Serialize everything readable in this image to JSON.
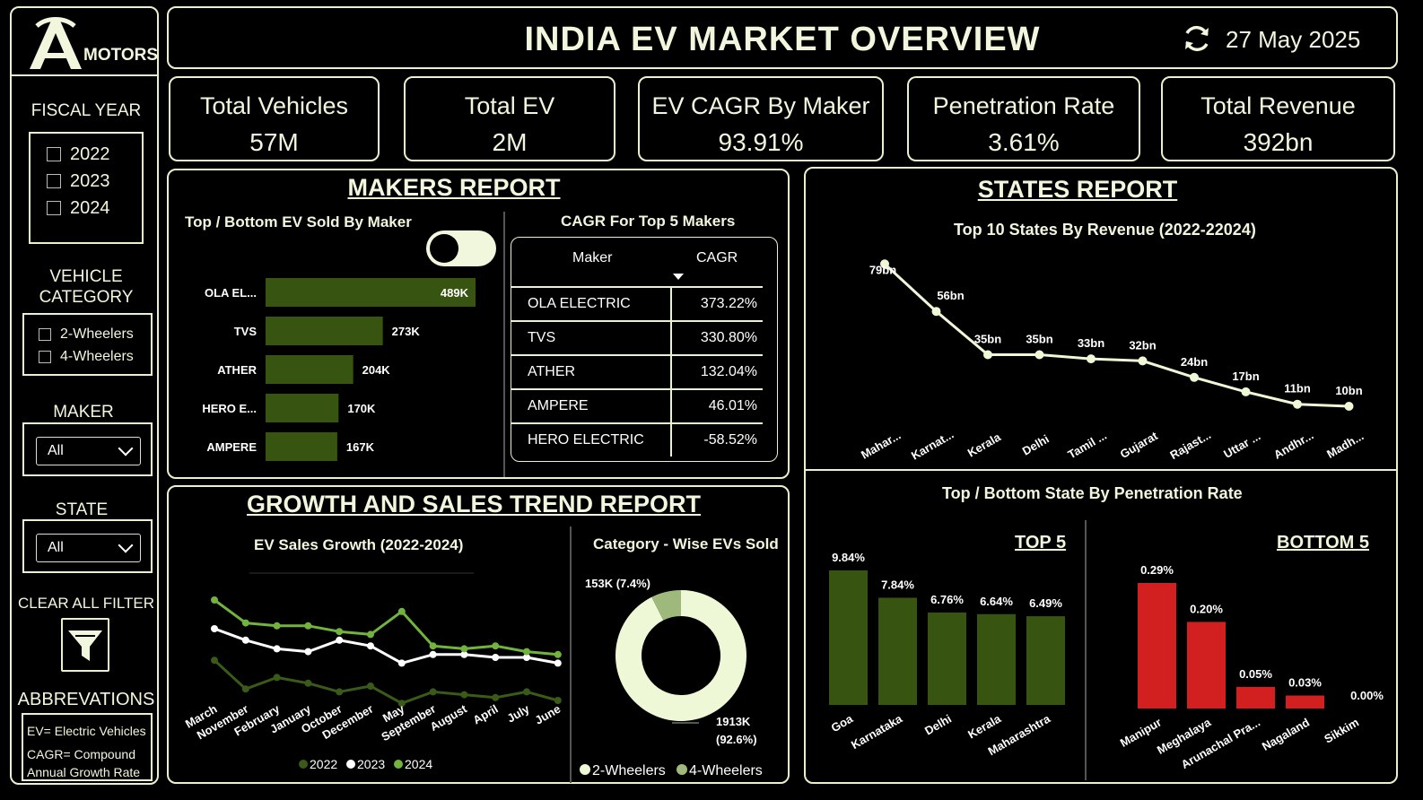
{
  "header": {
    "title": "INDIA EV MARKET OVERVIEW",
    "date": "27 May 2025"
  },
  "logo": {
    "text": "MOTORS",
    "letter": "A"
  },
  "sidebar": {
    "fiscal_year_label": "FISCAL YEAR",
    "fiscal_years": [
      "2022",
      "2023",
      "2024"
    ],
    "vehicle_category_label": "VEHICLE\nCATEGORY",
    "vehicle_categories": [
      "2-Wheelers",
      "4-Wheelers"
    ],
    "maker_label": "MAKER",
    "maker_value": "All",
    "state_label": "STATE",
    "state_value": "All",
    "clear_label": "CLEAR ALL FILTER",
    "abbrev_label": "ABBREVATIONS",
    "abbrev_lines": [
      "EV= Electric Vehicles",
      "CAGR= Compound",
      "Annual Growth Rate"
    ]
  },
  "kpis": [
    {
      "title": "Total Vehicles",
      "value": "57M"
    },
    {
      "title": "Total EV",
      "value": "2M"
    },
    {
      "title": "EV CAGR By Maker",
      "value": "93.91%"
    },
    {
      "title": "Penetration Rate",
      "value": "3.61%"
    },
    {
      "title": "Total Revenue",
      "value": "392bn"
    }
  ],
  "makers_report": {
    "title": "MAKERS REPORT",
    "bar_title": "Top / Bottom EV Sold By Maker",
    "table_title": "CAGR For Top 5 Makers",
    "table_headers": [
      "Maker",
      "CAGR"
    ],
    "table_rows": [
      [
        "OLA ELECTRIC",
        "373.22%"
      ],
      [
        "TVS",
        "330.80%"
      ],
      [
        "ATHER",
        "132.04%"
      ],
      [
        "AMPERE",
        "46.01%"
      ],
      [
        "HERO ELECTRIC",
        "-58.52%"
      ]
    ]
  },
  "states_report": {
    "title": "STATES REPORT",
    "line_title": "Top 10 States By Revenue (2022-22024)",
    "pen_title": "Top / Bottom State By Penetration Rate",
    "top_label": "TOP 5",
    "bottom_label": "BOTTOM 5"
  },
  "growth_report": {
    "title": "GROWTH AND SALES TREND REPORT",
    "line_title": "EV Sales Growth (2022-2024)",
    "donut_title": "Category - Wise EVs Sold"
  },
  "colors": {
    "accent": "#e8f2cc",
    "bar_green": "#375410",
    "bar_red": "#d21f1f",
    "line_2024": "#72b33e",
    "line_2022": "#3a5a18",
    "donut_main": "#eef8d6",
    "donut_small": "#9fb97c"
  },
  "chart_data": [
    {
      "id": "maker_bars",
      "type": "bar",
      "orientation": "horizontal",
      "title": "Top / Bottom EV Sold By Maker",
      "categories": [
        "OLA EL...",
        "TVS",
        "ATHER",
        "HERO E...",
        "AMPERE"
      ],
      "values": [
        489,
        273,
        204,
        170,
        167
      ],
      "labels": [
        "489K",
        "273K",
        "204K",
        "170K",
        "167K"
      ],
      "unit": "K"
    },
    {
      "id": "state_revenue",
      "type": "line",
      "title": "Top 10 States By Revenue (2022-22024)",
      "categories": [
        "Mahar...",
        "Karnat...",
        "Kerala",
        "Delhi",
        "Tamil ...",
        "Gujarat",
        "Rajast...",
        "Uttar ...",
        "Andhr...",
        "Madh..."
      ],
      "values": [
        79,
        56,
        35,
        35,
        33,
        32,
        24,
        17,
        11,
        10
      ],
      "labels": [
        "79bn",
        "56bn",
        "35bn",
        "35bn",
        "33bn",
        "32bn",
        "24bn",
        "17bn",
        "11bn",
        "10bn"
      ]
    },
    {
      "id": "top5_penetration",
      "type": "bar",
      "title": "TOP 5",
      "categories": [
        "Goa",
        "Karnataka",
        "Delhi",
        "Kerala",
        "Maharashtra"
      ],
      "values": [
        9.84,
        7.84,
        6.76,
        6.64,
        6.49
      ],
      "labels": [
        "9.84%",
        "7.84%",
        "6.76%",
        "6.64%",
        "6.49%"
      ]
    },
    {
      "id": "bottom5_penetration",
      "type": "bar",
      "title": "BOTTOM 5",
      "categories": [
        "Manipur",
        "Meghalaya",
        "Arunachal Pra...",
        "Nagaland",
        "Sikkim"
      ],
      "values": [
        0.29,
        0.2,
        0.05,
        0.03,
        0.0
      ],
      "labels": [
        "0.29%",
        "0.20%",
        "0.05%",
        "0.03%",
        "0.00%"
      ]
    },
    {
      "id": "sales_growth",
      "type": "line",
      "title": "EV Sales Growth (2022-2024)",
      "categories": [
        "March",
        "November",
        "February",
        "January",
        "October",
        "December",
        "May",
        "September",
        "August",
        "April",
        "July",
        "June"
      ],
      "series": [
        {
          "name": "2022",
          "values": [
            69,
            59,
            63,
            61,
            58,
            60,
            54,
            58,
            57,
            56,
            58,
            55
          ]
        },
        {
          "name": "2023",
          "values": [
            80,
            76,
            73,
            72,
            76,
            74,
            68,
            71,
            71,
            70,
            70,
            68
          ]
        },
        {
          "name": "2024",
          "values": [
            90,
            82,
            81,
            81,
            79,
            78,
            86,
            74,
            73,
            74,
            72,
            71
          ]
        }
      ]
    },
    {
      "id": "category_donut",
      "type": "pie",
      "title": "Category - Wise EVs Sold",
      "categories": [
        "2-Wheelers",
        "4-Wheelers"
      ],
      "values": [
        1913,
        153
      ],
      "labels": [
        "1913K",
        "(92.6%)",
        "153K (7.4%)"
      ],
      "legend": [
        "2-Wheelers",
        "4-Wheelers"
      ]
    }
  ]
}
